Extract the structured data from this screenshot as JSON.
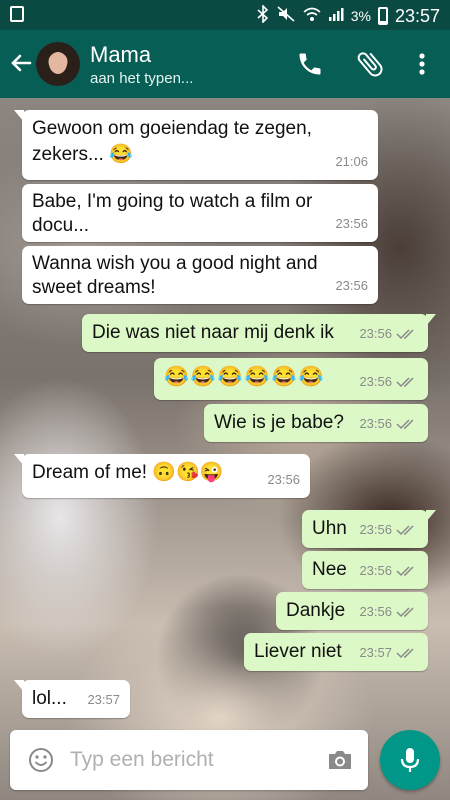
{
  "status_bar": {
    "icons": [
      "android-status-icon",
      "bluetooth-icon",
      "mute-icon",
      "wifi-icon",
      "signal-icon",
      "battery-icon"
    ],
    "battery": "3%",
    "time": "23:57"
  },
  "header": {
    "contact_name": "Mama",
    "status": "aan het typen...",
    "actions": [
      "call-icon",
      "attachment-icon",
      "more-vert-icon"
    ],
    "color": "#075e54"
  },
  "messages": [
    {
      "dir": "in",
      "text": "Gewoon om goeiendag te zegen, zekers... 😂",
      "time": "21:06"
    },
    {
      "dir": "in",
      "text": "Babe, I'm going to watch a film or docu...",
      "time": "23:56"
    },
    {
      "dir": "in",
      "text": "Wanna wish you a good night and sweet dreams!",
      "time": "23:56"
    },
    {
      "dir": "out",
      "text": "Die was niet naar mij denk ik",
      "time": "23:56"
    },
    {
      "dir": "out",
      "text": "😂😂😂😂😂😂",
      "time": "23:56"
    },
    {
      "dir": "out",
      "text": "Wie is je babe?",
      "time": "23:56"
    },
    {
      "dir": "in",
      "text": "Dream of me! 🙃😘😜",
      "time": "23:56"
    },
    {
      "dir": "out",
      "text": "Uhn",
      "time": "23:56"
    },
    {
      "dir": "out",
      "text": "Nee",
      "time": "23:56"
    },
    {
      "dir": "out",
      "text": "Dankje",
      "time": "23:56"
    },
    {
      "dir": "out",
      "text": "Liever niet",
      "time": "23:57"
    },
    {
      "dir": "in",
      "text": "lol...",
      "time": "23:57"
    }
  ],
  "composer": {
    "placeholder": "Typ een bericht",
    "icons": [
      "emoji-icon",
      "camera-icon",
      "mic-icon"
    ]
  },
  "colors": {
    "incoming_bubble": "#ffffff",
    "outgoing_bubble": "#dcf8c6",
    "accent": "#009688"
  }
}
